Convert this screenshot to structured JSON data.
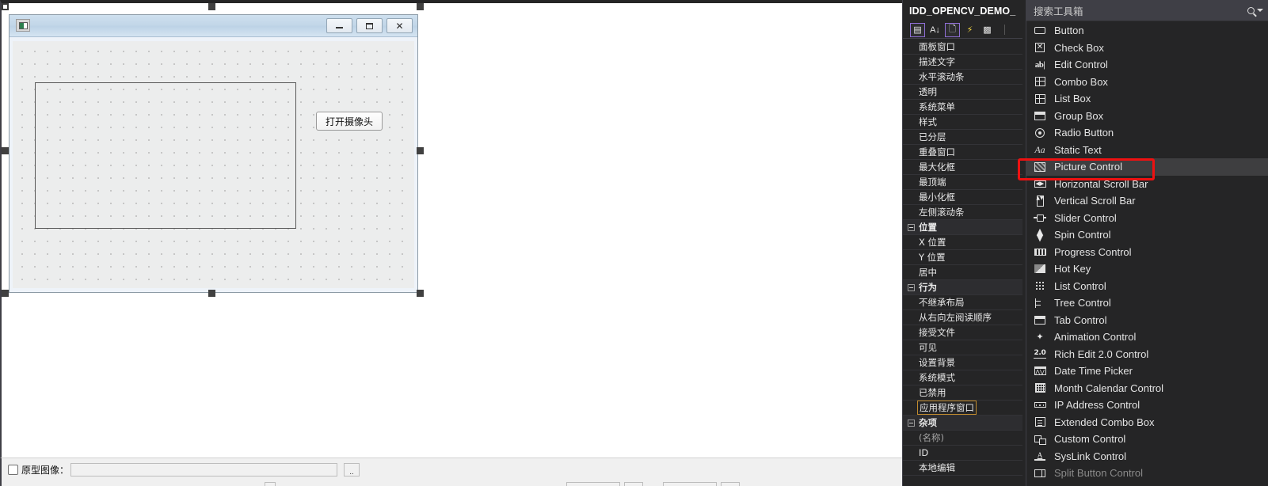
{
  "designer": {
    "dialog": {
      "app_icon": "application-icon",
      "titlebar_buttons": [
        {
          "name": "minimize-button",
          "glyph": "—"
        },
        {
          "name": "maximize-button",
          "glyph": "❐"
        },
        {
          "name": "close-button",
          "glyph": "✖"
        }
      ],
      "controls": {
        "picture_control_name": "picture-control-placeholder",
        "open_camera_button": "打开摄像头"
      }
    }
  },
  "bottom_bar": {
    "prototype_checkbox_label": "原型图像：",
    "prototype_path_value": "",
    "browse_button_label": ".."
  },
  "properties": {
    "title": "IDD_OPENCV_DEMO_",
    "toolbar": [
      {
        "name": "categorized-view-button",
        "glyph": "▤",
        "active": true
      },
      {
        "name": "alphabetical-sort-button",
        "glyph": "A↓",
        "active": false
      },
      {
        "name": "property-pages-button",
        "glyph": "🗒",
        "active": true
      },
      {
        "name": "events-button",
        "glyph": "⚡",
        "active": false
      },
      {
        "name": "property-messages-button",
        "glyph": "▨",
        "active": false
      }
    ],
    "rows": [
      {
        "label": "面板窗口",
        "type": "item"
      },
      {
        "label": "描述文字",
        "type": "item"
      },
      {
        "label": "水平滚动条",
        "type": "item"
      },
      {
        "label": "透明",
        "type": "item"
      },
      {
        "label": "系统菜单",
        "type": "item"
      },
      {
        "label": "样式",
        "type": "item"
      },
      {
        "label": "已分层",
        "type": "item"
      },
      {
        "label": "重叠窗口",
        "type": "item"
      },
      {
        "label": "最大化框",
        "type": "item"
      },
      {
        "label": "最顶端",
        "type": "item"
      },
      {
        "label": "最小化框",
        "type": "item"
      },
      {
        "label": "左侧滚动条",
        "type": "item"
      },
      {
        "label": "位置",
        "type": "group"
      },
      {
        "label": "X 位置",
        "type": "item"
      },
      {
        "label": "Y 位置",
        "type": "item"
      },
      {
        "label": "居中",
        "type": "item"
      },
      {
        "label": "行为",
        "type": "group"
      },
      {
        "label": "不继承布局",
        "type": "item"
      },
      {
        "label": "从右向左阅读顺序",
        "type": "item"
      },
      {
        "label": "接受文件",
        "type": "item"
      },
      {
        "label": "可见",
        "type": "item"
      },
      {
        "label": "设置背景",
        "type": "item"
      },
      {
        "label": "系统模式",
        "type": "item"
      },
      {
        "label": "已禁用",
        "type": "item"
      },
      {
        "label": "应用程序窗口",
        "type": "item",
        "selected": true
      },
      {
        "label": "杂项",
        "type": "group"
      },
      {
        "label": "(名称)",
        "type": "item",
        "dim": true
      },
      {
        "label": "ID",
        "type": "item"
      },
      {
        "label": "本地编辑",
        "type": "item"
      }
    ]
  },
  "toolbox": {
    "search_placeholder": "搜索工具箱",
    "search_icon": "search-icon",
    "dropdown_icon": "chevron-down-icon",
    "items": [
      {
        "label": "Button",
        "icon": "button-icon"
      },
      {
        "label": "Check Box",
        "icon": "checkbox-icon"
      },
      {
        "label": "Edit Control",
        "icon": "edit-control-icon"
      },
      {
        "label": "Combo Box",
        "icon": "combo-box-icon"
      },
      {
        "label": "List Box",
        "icon": "list-box-icon"
      },
      {
        "label": "Group Box",
        "icon": "group-box-icon"
      },
      {
        "label": "Radio Button",
        "icon": "radio-button-icon"
      },
      {
        "label": "Static Text",
        "icon": "static-text-icon"
      },
      {
        "label": "Picture Control",
        "icon": "picture-control-icon",
        "highlighted": true
      },
      {
        "label": "Horizontal Scroll Bar",
        "icon": "horizontal-scroll-bar-icon"
      },
      {
        "label": "Vertical Scroll Bar",
        "icon": "vertical-scroll-bar-icon"
      },
      {
        "label": "Slider Control",
        "icon": "slider-control-icon"
      },
      {
        "label": "Spin Control",
        "icon": "spin-control-icon"
      },
      {
        "label": "Progress Control",
        "icon": "progress-control-icon"
      },
      {
        "label": "Hot Key",
        "icon": "hot-key-icon"
      },
      {
        "label": "List Control",
        "icon": "list-control-icon"
      },
      {
        "label": "Tree Control",
        "icon": "tree-control-icon"
      },
      {
        "label": "Tab Control",
        "icon": "tab-control-icon"
      },
      {
        "label": "Animation Control",
        "icon": "animation-control-icon"
      },
      {
        "label": "Rich Edit 2.0 Control",
        "icon": "rich-edit-icon"
      },
      {
        "label": "Date Time Picker",
        "icon": "date-time-picker-icon"
      },
      {
        "label": "Month Calendar Control",
        "icon": "month-calendar-icon"
      },
      {
        "label": "IP Address Control",
        "icon": "ip-address-icon"
      },
      {
        "label": "Extended Combo Box",
        "icon": "extended-combo-box-icon"
      },
      {
        "label": "Custom Control",
        "icon": "custom-control-icon"
      },
      {
        "label": "SysLink Control",
        "icon": "syslink-control-icon"
      },
      {
        "label": "Split Button Control",
        "icon": "split-button-icon"
      }
    ]
  },
  "annotation": {
    "color": "#ee1111",
    "target": "Picture Control"
  }
}
